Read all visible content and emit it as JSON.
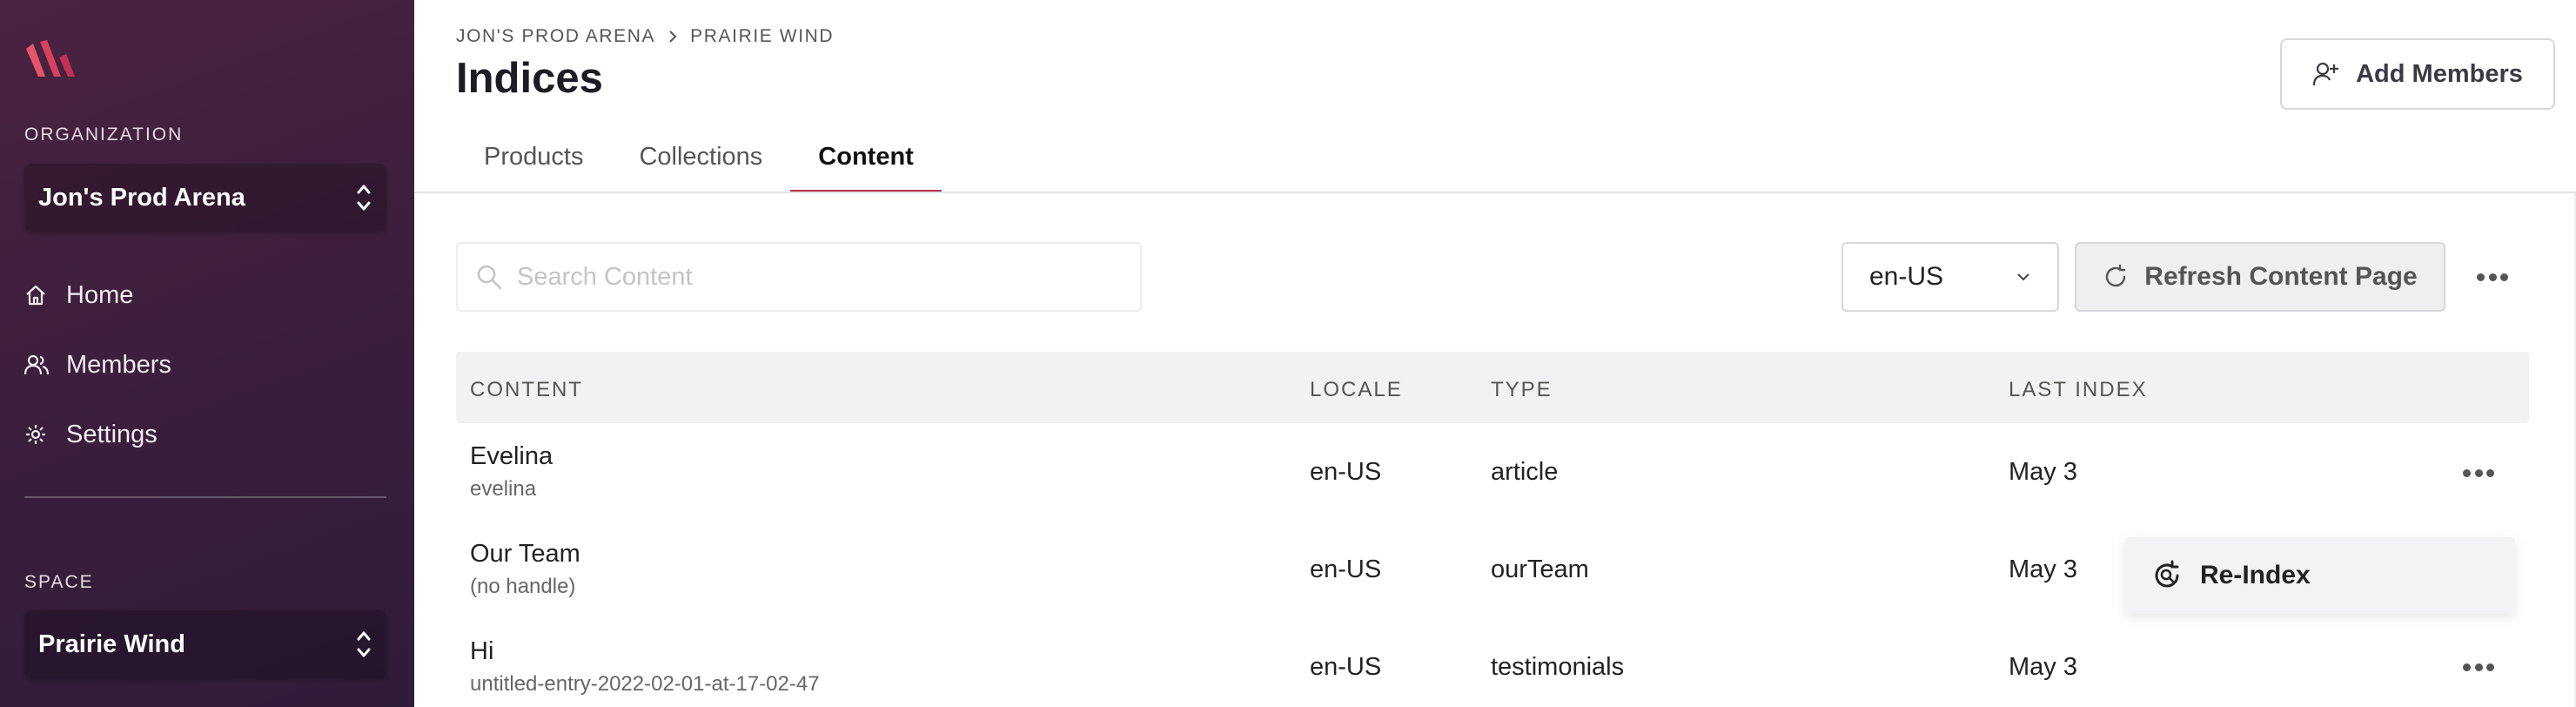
{
  "sidebar": {
    "organization_label": "ORGANIZATION",
    "organization_name": "Jon's Prod Arena",
    "nav": [
      {
        "label": "Home",
        "icon": "home-icon"
      },
      {
        "label": "Members",
        "icon": "users-icon"
      },
      {
        "label": "Settings",
        "icon": "gear-icon"
      }
    ],
    "space_label": "SPACE",
    "space_name": "Prairie Wind"
  },
  "header": {
    "breadcrumb": [
      "JON'S PROD ARENA",
      "PRAIRIE WIND"
    ],
    "title": "Indices",
    "add_members_label": "Add Members"
  },
  "tabs": [
    {
      "label": "Products",
      "active": false
    },
    {
      "label": "Collections",
      "active": false
    },
    {
      "label": "Content",
      "active": true
    }
  ],
  "toolbar": {
    "search_placeholder": "Search Content",
    "search_value": "",
    "locale": "en-US",
    "refresh_label": "Refresh Content Page"
  },
  "table": {
    "columns": [
      "CONTENT",
      "LOCALE",
      "TYPE",
      "LAST INDEX"
    ],
    "rows": [
      {
        "name": "Evelina",
        "handle": "evelina",
        "locale": "en-US",
        "type": "article",
        "last_index": "May 3"
      },
      {
        "name": "Our Team",
        "handle": "(no handle)",
        "locale": "en-US",
        "type": "ourTeam",
        "last_index": "May 3"
      },
      {
        "name": "Hi",
        "handle": "untitled-entry-2022-02-01-at-17-02-47",
        "locale": "en-US",
        "type": "testimonials",
        "last_index": "May 3"
      }
    ]
  },
  "row_menu": {
    "item_label": "Re-Index",
    "icon": "reindex-icon"
  },
  "colors": {
    "sidebar_bg": "#3c1f3d",
    "accent": "#b8324f",
    "table_header_bg": "#f0f2f3"
  }
}
